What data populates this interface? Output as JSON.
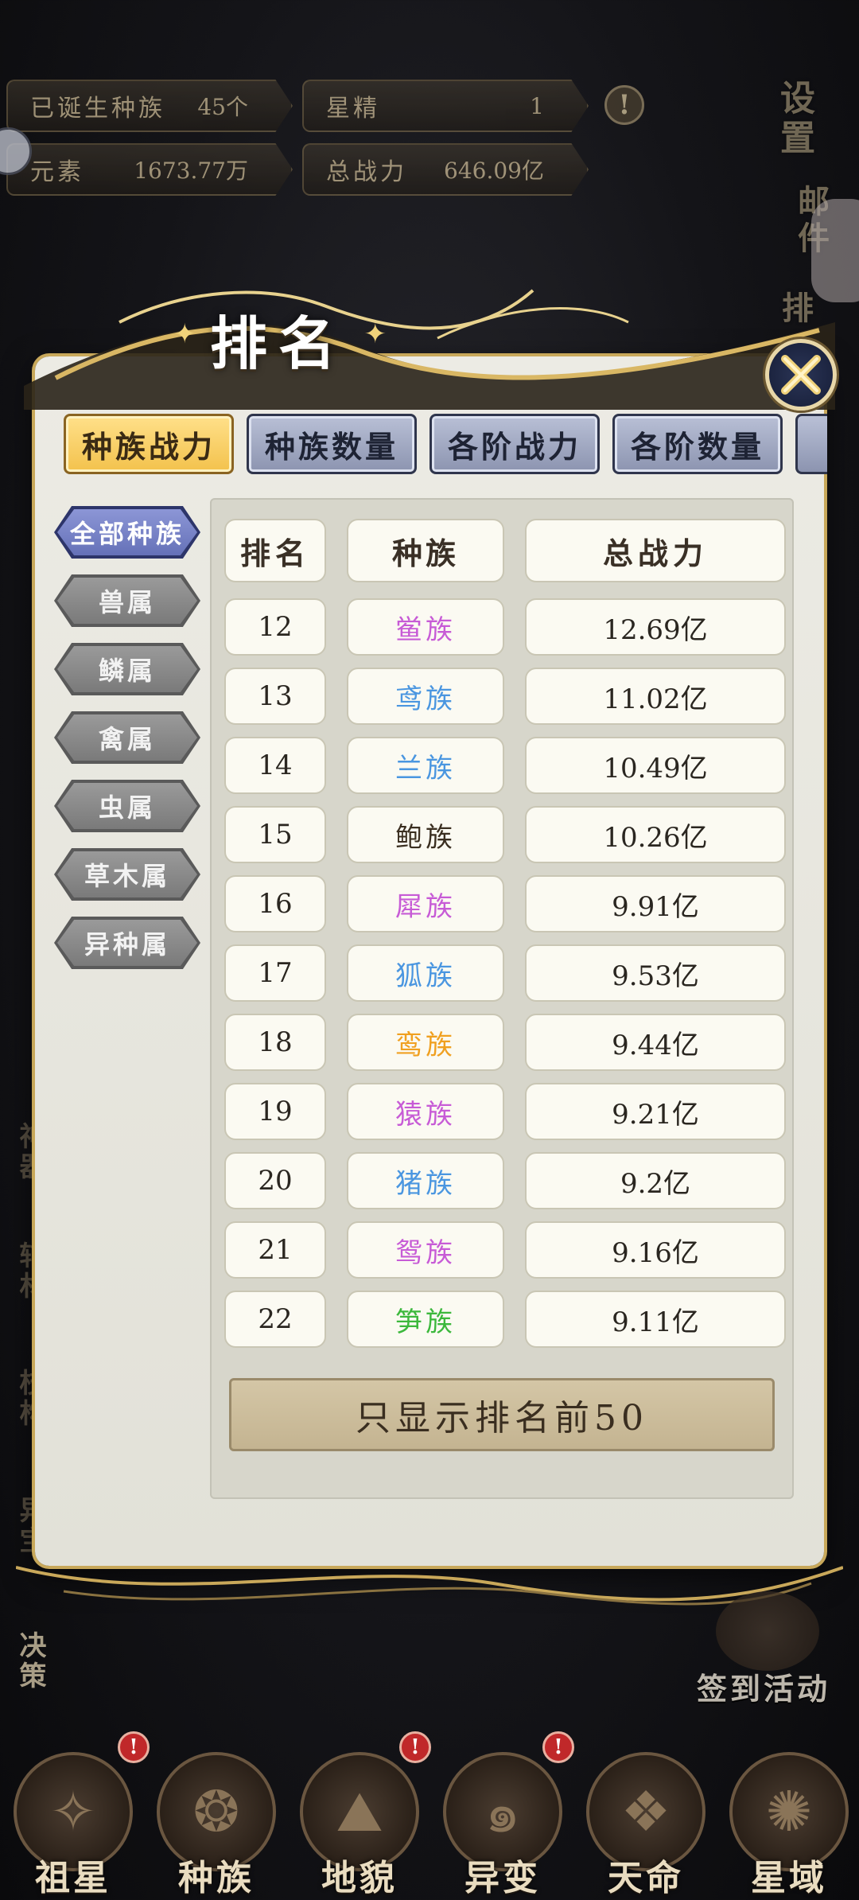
{
  "hud": {
    "born_races_label": "已诞生种族",
    "born_races_value": "45个",
    "star_essence_label": "星精",
    "star_essence_value": "1",
    "element_label": "元素",
    "element_value": "1673.77万",
    "total_power_label": "总战力",
    "total_power_value": "646.09亿",
    "warn_mark": "!"
  },
  "right_side": {
    "settings": "设置",
    "mail": "邮件",
    "rank": "排"
  },
  "left_side": [
    "神器",
    "辅材",
    "枝构",
    "异宝",
    "决策"
  ],
  "modal": {
    "title": "排名",
    "tabs": [
      "种族战力",
      "种族数量",
      "各阶战力",
      "各阶数量"
    ],
    "categories": [
      "全部种族",
      "兽属",
      "鳞属",
      "禽属",
      "虫属",
      "草木属",
      "异种属"
    ],
    "table": {
      "headers": [
        "排名",
        "种族",
        "总战力"
      ],
      "rows": [
        {
          "rank": "12",
          "race": "鲎族",
          "power": "12.69亿",
          "color": "#c75bd6"
        },
        {
          "rank": "13",
          "race": "鸢族",
          "power": "11.02亿",
          "color": "#4a96e0"
        },
        {
          "rank": "14",
          "race": "兰族",
          "power": "10.49亿",
          "color": "#4a96e0"
        },
        {
          "rank": "15",
          "race": "鲍族",
          "power": "10.26亿",
          "color": "#3a2e20"
        },
        {
          "rank": "16",
          "race": "犀族",
          "power": "9.91亿",
          "color": "#c75bd6"
        },
        {
          "rank": "17",
          "race": "狐族",
          "power": "9.53亿",
          "color": "#4a96e0"
        },
        {
          "rank": "18",
          "race": "鸾族",
          "power": "9.44亿",
          "color": "#f0a020"
        },
        {
          "rank": "19",
          "race": "猿族",
          "power": "9.21亿",
          "color": "#c75bd6"
        },
        {
          "rank": "20",
          "race": "猪族",
          "power": "9.2亿",
          "color": "#4a96e0"
        },
        {
          "rank": "21",
          "race": "鸳族",
          "power": "9.16亿",
          "color": "#c75bd6"
        },
        {
          "rank": "22",
          "race": "笋族",
          "power": "9.11亿",
          "color": "#3cb83c"
        }
      ]
    },
    "filter_button": "只显示排名前50"
  },
  "checkin_label": "签到活动",
  "bottom_nav": [
    "祖星",
    "种族",
    "地貌",
    "异变",
    "天命",
    "星域"
  ]
}
